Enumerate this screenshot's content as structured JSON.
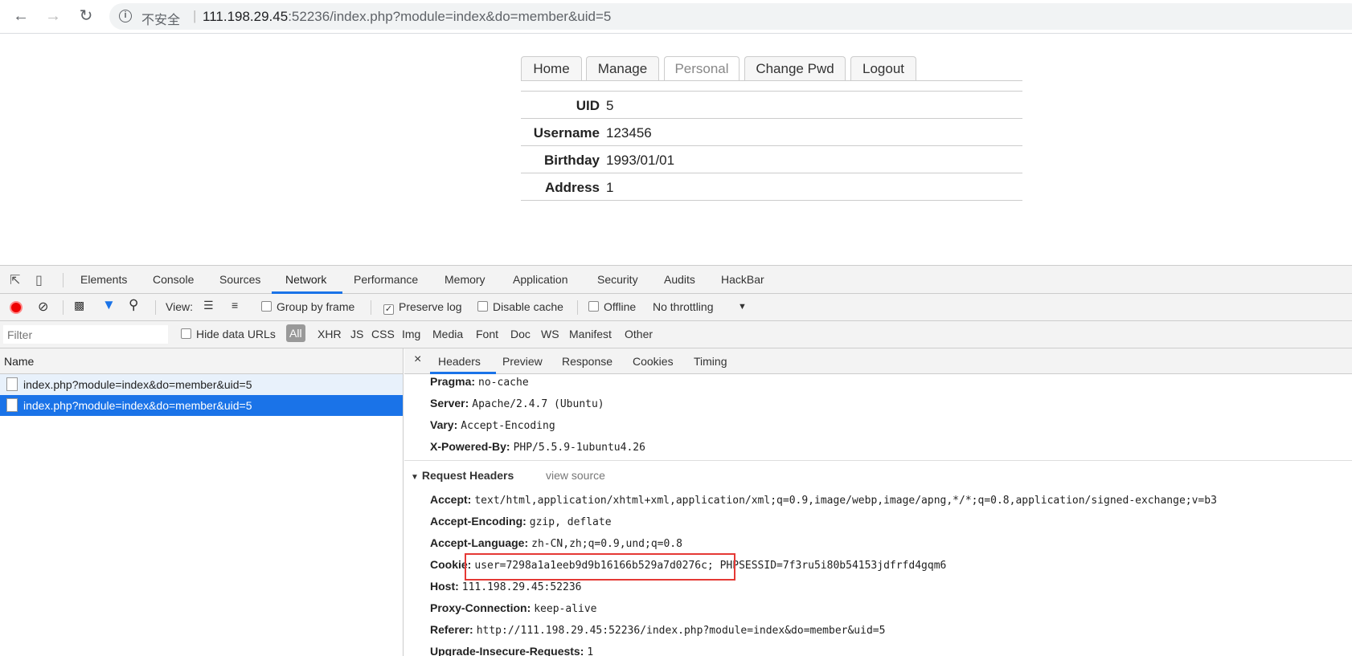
{
  "browser": {
    "insecure_label": "不安全",
    "url_host": "111.198.29.45",
    "url_rest": ":52236/index.php?module=index&do=member&uid=5"
  },
  "page": {
    "tabs": [
      "Home",
      "Manage",
      "Personal",
      "Change Pwd",
      "Logout"
    ],
    "active_tab": "Personal",
    "rows": [
      {
        "key": "UID",
        "value": "5"
      },
      {
        "key": "Username",
        "value": "123456"
      },
      {
        "key": "Birthday",
        "value": "1993/01/01"
      },
      {
        "key": "Address",
        "value": "1"
      }
    ]
  },
  "devtools": {
    "tabs": [
      "Elements",
      "Console",
      "Sources",
      "Network",
      "Performance",
      "Memory",
      "Application",
      "Security",
      "Audits",
      "HackBar"
    ],
    "active_tab": "Network",
    "toolbar": {
      "view_label": "View:",
      "group_by_frame": "Group by frame",
      "preserve_log": "Preserve log",
      "disable_cache": "Disable cache",
      "offline": "Offline",
      "throttling": "No throttling"
    },
    "filter": {
      "placeholder": "Filter",
      "hide_data_urls": "Hide data URLs",
      "types": [
        "All",
        "XHR",
        "JS",
        "CSS",
        "Img",
        "Media",
        "Font",
        "Doc",
        "WS",
        "Manifest",
        "Other"
      ]
    },
    "name_header": "Name",
    "requests": [
      "index.php?module=index&do=member&uid=5",
      "index.php?module=index&do=member&uid=5"
    ],
    "detail_tabs": [
      "Headers",
      "Preview",
      "Response",
      "Cookies",
      "Timing"
    ],
    "response_headers": [
      {
        "key": "Pragma:",
        "value": "no-cache"
      },
      {
        "key": "Server:",
        "value": "Apache/2.4.7 (Ubuntu)"
      },
      {
        "key": "Vary:",
        "value": "Accept-Encoding"
      },
      {
        "key": "X-Powered-By:",
        "value": "PHP/5.5.9-1ubuntu4.26"
      }
    ],
    "request_headers_title": "Request Headers",
    "view_source": "view source",
    "request_headers": [
      {
        "key": "Accept:",
        "value": "text/html,application/xhtml+xml,application/xml;q=0.9,image/webp,image/apng,*/*;q=0.8,application/signed-exchange;v=b3"
      },
      {
        "key": "Accept-Encoding:",
        "value": "gzip, deflate"
      },
      {
        "key": "Accept-Language:",
        "value": "zh-CN,zh;q=0.9,und;q=0.8"
      },
      {
        "key": "Cookie:",
        "value": "user=7298a1a1eeb9d9b16166b529a7d0276c; PHPSESSID=7f3ru5i80b54153jdfrfd4gqm6"
      },
      {
        "key": "Host:",
        "value": "111.198.29.45:52236"
      },
      {
        "key": "Proxy-Connection:",
        "value": "keep-alive"
      },
      {
        "key": "Referer:",
        "value": "http://111.198.29.45:52236/index.php?module=index&do=member&uid=5"
      },
      {
        "key": "Upgrade-Insecure-Requests:",
        "value": "1"
      }
    ],
    "highlight_color": "#e53935",
    "accent_color": "#1a73e8"
  }
}
